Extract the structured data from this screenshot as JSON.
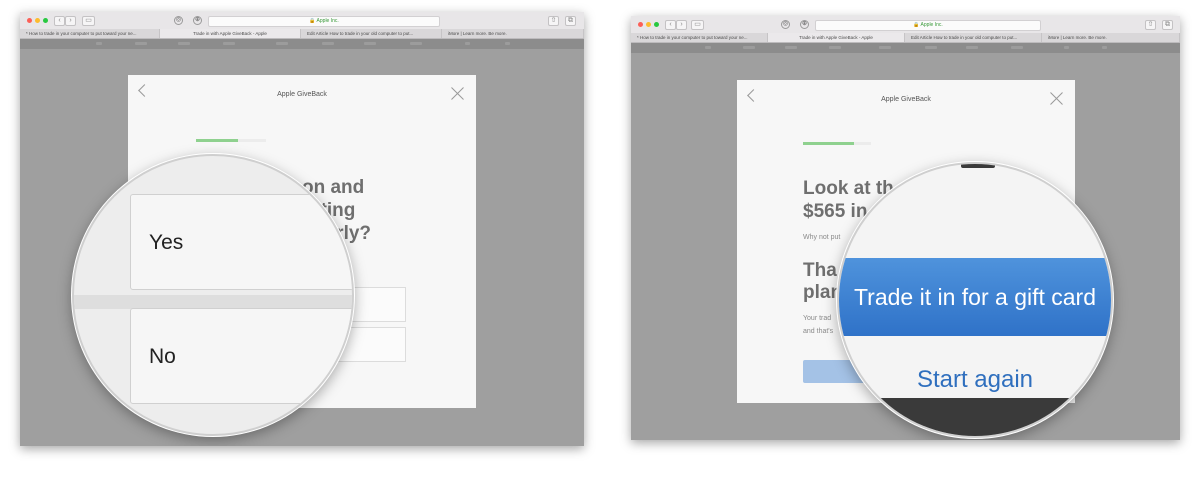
{
  "left": {
    "browser": {
      "url": "Apple Inc.",
      "tabs": [
        "* How to trade in your computer to put toward your ne...",
        "Trade in with Apple GiveBack - Apple",
        "Edit Article How to trade in your old computer to put...",
        "iMore | Learn more. Be more."
      ]
    },
    "modal": {
      "title": "Apple GiveBack",
      "progress": 0.6,
      "question": [
        "on and",
        "ating",
        "perly?"
      ]
    },
    "lens": {
      "options": [
        "Yes",
        "No"
      ]
    }
  },
  "right": {
    "browser": {
      "url": "Apple Inc.",
      "tabs": [
        "* How to trade in your computer to put toward your ne...",
        "Trade in with Apple GiveBack - Apple",
        "Edit Article How to trade in your old computer to put...",
        "iMore | Learn more. Be more."
      ]
    },
    "modal": {
      "title": "Apple GiveBack",
      "progress": 0.75,
      "heading_lines": [
        "Look at th",
        "$565 in"
      ],
      "subtext": "Why not put",
      "heading2_lines": [
        "Tha",
        "plan"
      ],
      "para_lines": [
        "Your trad",
        "and that's"
      ]
    },
    "lens": {
      "primary_button": "Trade it in for a gift card",
      "secondary_link": "Start again"
    }
  },
  "colors": {
    "accent_blue": "#3579cf",
    "progress_green": "#8fd18f",
    "link_blue": "#2f6fbe"
  }
}
